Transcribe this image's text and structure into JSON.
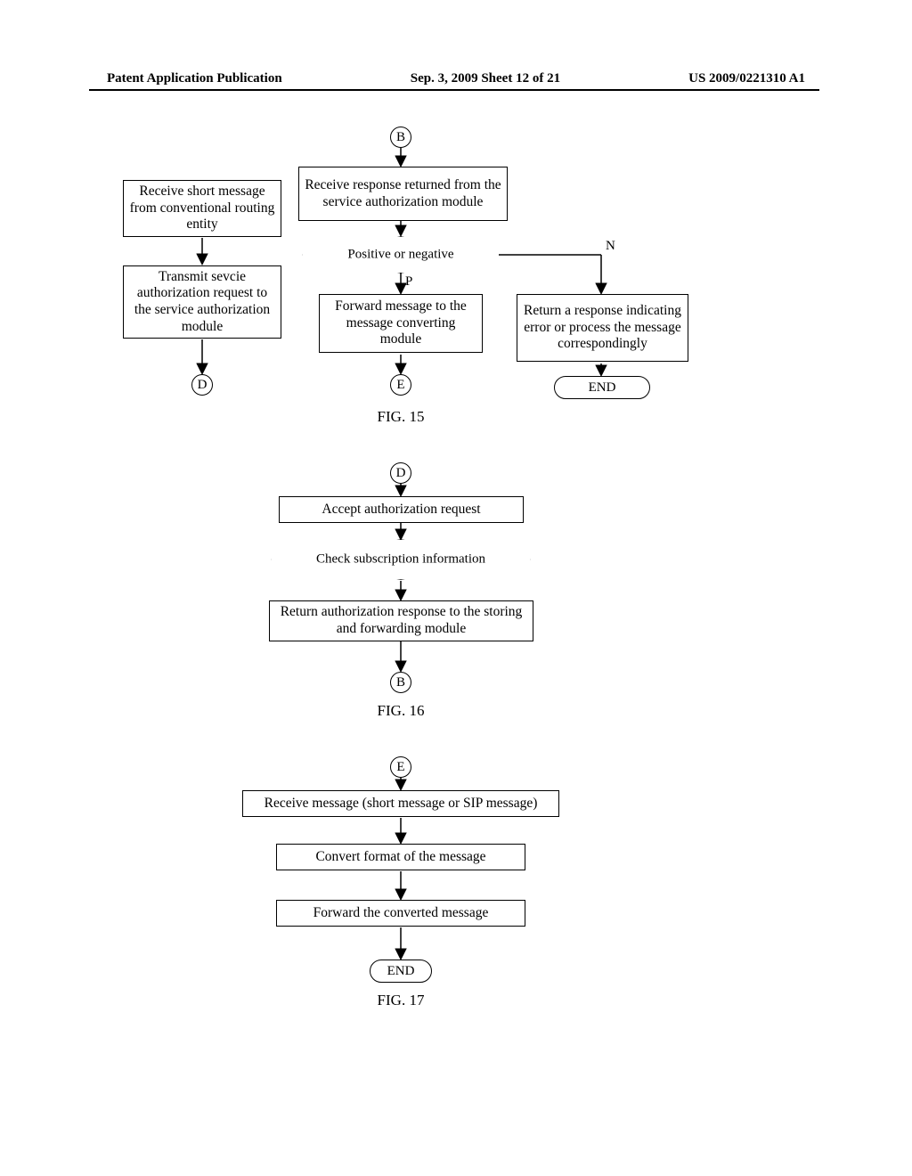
{
  "header": {
    "left": "Patent Application Publication",
    "center": "Sep. 3, 2009  Sheet 12 of 21",
    "right": "US 2009/0221310 A1"
  },
  "fig15": {
    "label": "FIG. 15",
    "connector_in": "B",
    "receive_response": "Receive response returned from the service authorization module",
    "decision": "Positive or negative",
    "branch_p": "P",
    "branch_n": "N",
    "receive_short": "Receive short message from conventional routing entity",
    "transmit": "Transmit sevcie authorization request to the service authorization module",
    "forward": "Forward message to the message converting module",
    "return_error": "Return a response indicating error or process the message correspondingly",
    "connector_d": "D",
    "connector_e": "E",
    "end": "END"
  },
  "fig16": {
    "label": "FIG. 16",
    "connector_in": "D",
    "accept": "Accept authorization request",
    "check": "Check subscription information",
    "return_auth": "Return authorization response to the storing and forwarding module",
    "connector_out": "B"
  },
  "fig17": {
    "label": "FIG. 17",
    "connector_in": "E",
    "receive": "Receive message (short message or SIP message)",
    "convert": "Convert format of the message",
    "forward": "Forward the converted message",
    "end": "END"
  }
}
